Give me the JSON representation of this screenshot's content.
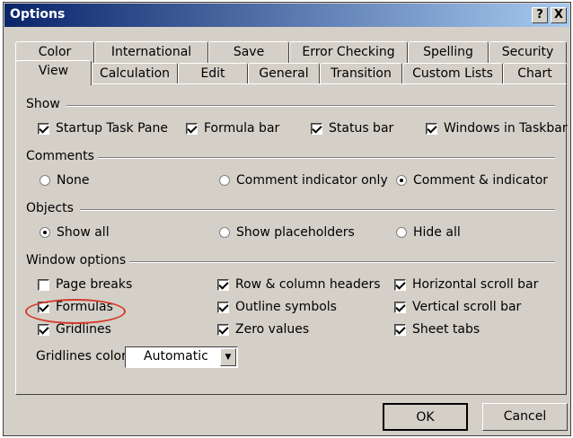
{
  "window": {
    "title": "Options",
    "help_label": "?",
    "close_label": "X"
  },
  "tabs_row1": [
    "Color",
    "International",
    "Save",
    "Error Checking",
    "Spelling",
    "Security"
  ],
  "tabs_row2": [
    "View",
    "Calculation",
    "Edit",
    "General",
    "Transition",
    "Custom Lists",
    "Chart"
  ],
  "active_tab": "View",
  "groups": {
    "show": "Show",
    "comments": "Comments",
    "objects": "Objects",
    "window": "Window options"
  },
  "show": [
    {
      "label": "Startup Task Pane",
      "checked": true
    },
    {
      "label": "Formula bar",
      "checked": true
    },
    {
      "label": "Status bar",
      "checked": true
    },
    {
      "label": "Windows in Taskbar",
      "checked": true
    }
  ],
  "comments": [
    {
      "label": "None",
      "selected": false
    },
    {
      "label": "Comment indicator only",
      "selected": false
    },
    {
      "label": "Comment & indicator",
      "selected": true
    }
  ],
  "objects": [
    {
      "label": "Show all",
      "selected": true
    },
    {
      "label": "Show placeholders",
      "selected": false
    },
    {
      "label": "Hide all",
      "selected": false
    }
  ],
  "window_options": [
    {
      "label": "Page breaks",
      "checked": false
    },
    {
      "label": "Row & column headers",
      "checked": true
    },
    {
      "label": "Horizontal scroll bar",
      "checked": true
    },
    {
      "label": "Formulas",
      "checked": true
    },
    {
      "label": "Outline symbols",
      "checked": true
    },
    {
      "label": "Vertical scroll bar",
      "checked": true
    },
    {
      "label": "Gridlines",
      "checked": true
    },
    {
      "label": "Zero values",
      "checked": true
    },
    {
      "label": "Sheet tabs",
      "checked": true
    }
  ],
  "gridlines_color": {
    "label": "Gridlines color:",
    "value": "Automatic"
  },
  "buttons": {
    "ok": "OK",
    "cancel": "Cancel"
  },
  "highlight_color": "#d43a2a"
}
